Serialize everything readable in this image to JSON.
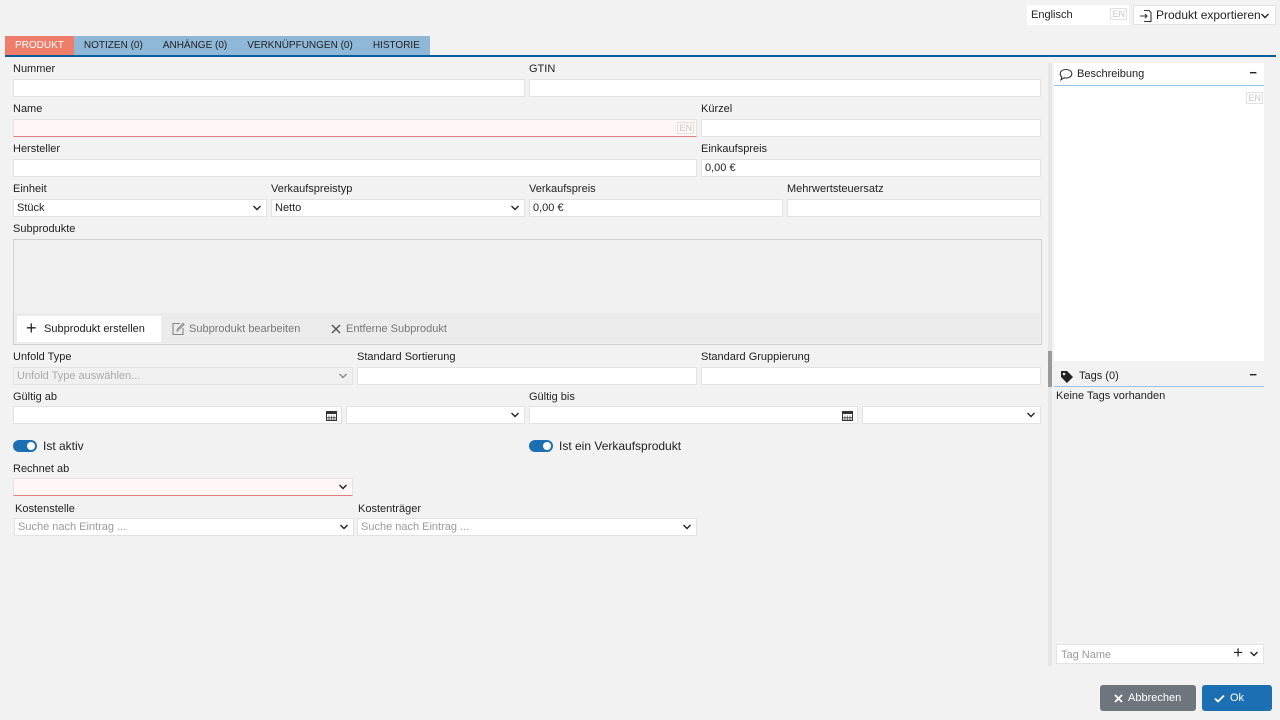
{
  "header": {
    "language_value": "Englisch",
    "language_tag": "EN",
    "export_label": "Produkt exportieren"
  },
  "tabs": [
    {
      "label": "PRODUKT"
    },
    {
      "label": "NOTIZEN (0)"
    },
    {
      "label": "ANHÄNGE (0)"
    },
    {
      "label": "VERKNÜPFUNGEN (0)"
    },
    {
      "label": "HISTORIE"
    }
  ],
  "form": {
    "nummer": {
      "label": "Nummer",
      "value": ""
    },
    "gtin": {
      "label": "GTIN",
      "value": ""
    },
    "name": {
      "label": "Name",
      "value": "",
      "lang": "EN"
    },
    "kuerzel": {
      "label": "Kürzel",
      "value": ""
    },
    "hersteller": {
      "label": "Hersteller",
      "value": ""
    },
    "einkaufspreis": {
      "label": "Einkaufspreis",
      "value": "0,00 €"
    },
    "einheit": {
      "label": "Einheit",
      "value": "Stück"
    },
    "verkaufspreistyp": {
      "label": "Verkaufspreistyp",
      "value": "Netto"
    },
    "verkaufspreis": {
      "label": "Verkaufspreis",
      "value": "0,00 €"
    },
    "mwst": {
      "label": "Mehrwertsteuersatz",
      "value": ""
    },
    "subprodukte": {
      "label": "Subprodukte",
      "create_label": "Subprodukt erstellen",
      "edit_label": "Subprodukt bearbeiten",
      "remove_label": "Entferne Subprodukt"
    },
    "unfold_type": {
      "label": "Unfold Type",
      "placeholder": "Unfold Type auswählen..."
    },
    "standard_sortierung": {
      "label": "Standard Sortierung",
      "value": ""
    },
    "standard_gruppierung": {
      "label": "Standard Gruppierung",
      "value": ""
    },
    "gueltig_ab": {
      "label": "Gültig ab",
      "value": ""
    },
    "gueltig_bis": {
      "label": "Gültig bis",
      "value": ""
    },
    "ist_aktiv": {
      "label": "Ist aktiv",
      "checked": true
    },
    "ist_verkaufsprodukt": {
      "label": "Ist ein Verkaufsprodukt",
      "checked": true
    },
    "rechnet_ab": {
      "label": "Rechnet ab",
      "value": ""
    },
    "kostenstelle": {
      "label": "Kostenstelle",
      "placeholder": "Suche nach Eintrag ..."
    },
    "kostentraeger": {
      "label": "Kostenträger",
      "placeholder": "Suche nach Eintrag ..."
    }
  },
  "sidebar": {
    "beschreibung": {
      "title": "Beschreibung",
      "lang": "EN"
    },
    "tags": {
      "title": "Tags (0)",
      "empty_text": "Keine Tags vorhanden",
      "input_placeholder": "Tag Name"
    }
  },
  "footer": {
    "cancel_label": "Abbrechen",
    "ok_label": "Ok"
  },
  "colors": {
    "accent": "#1d6fb3",
    "tab_active": "#f07c6a",
    "tab_inactive": "#8fb7d8",
    "cancel_button": "#6f757c"
  }
}
